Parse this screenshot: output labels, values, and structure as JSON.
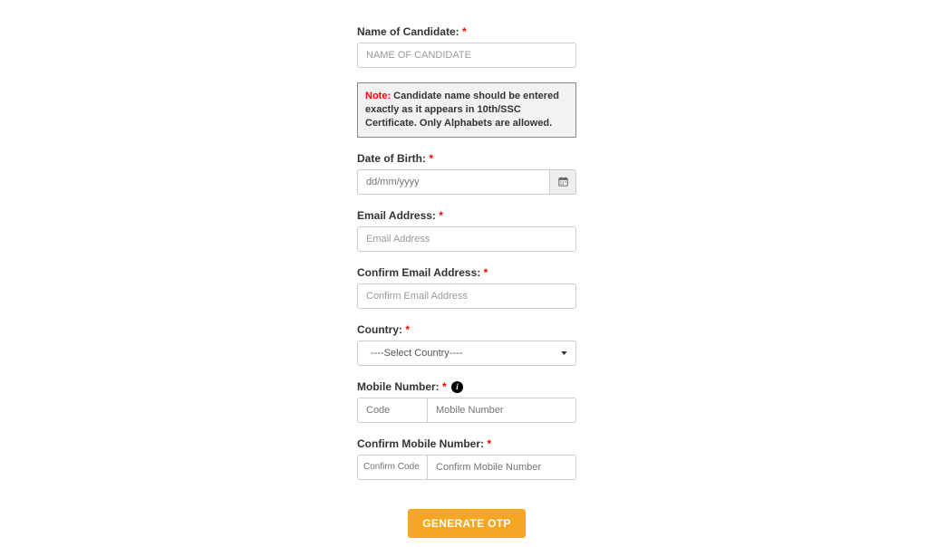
{
  "fields": {
    "nameCandidate": {
      "label": "Name of Candidate:",
      "placeholder": "NAME OF CANDIDATE"
    },
    "note": {
      "prefix": "Note:",
      "text": " Candidate name should be entered exactly as it appears in 10th/SSC Certificate. Only Alphabets are allowed."
    },
    "dob": {
      "label": "Date of Birth:",
      "placeholder": "dd/mm/yyyy"
    },
    "email": {
      "label": "Email Address:",
      "placeholder": "Email Address"
    },
    "confirmEmail": {
      "label": "Confirm Email Address:",
      "placeholder": "Confirm Email Address"
    },
    "country": {
      "label": "Country:",
      "option": "----Select Country----"
    },
    "mobile": {
      "label": "Mobile Number:",
      "codePh": "Code",
      "numberPh": "Mobile Number"
    },
    "confirmMobile": {
      "label": "Confirm Mobile Number:",
      "codePh": "Confirm Code",
      "numberPh": "Confirm Mobile Number"
    }
  },
  "button": {
    "generate": "GENERATE OTP"
  },
  "symbols": {
    "star": " *",
    "info": "i"
  }
}
